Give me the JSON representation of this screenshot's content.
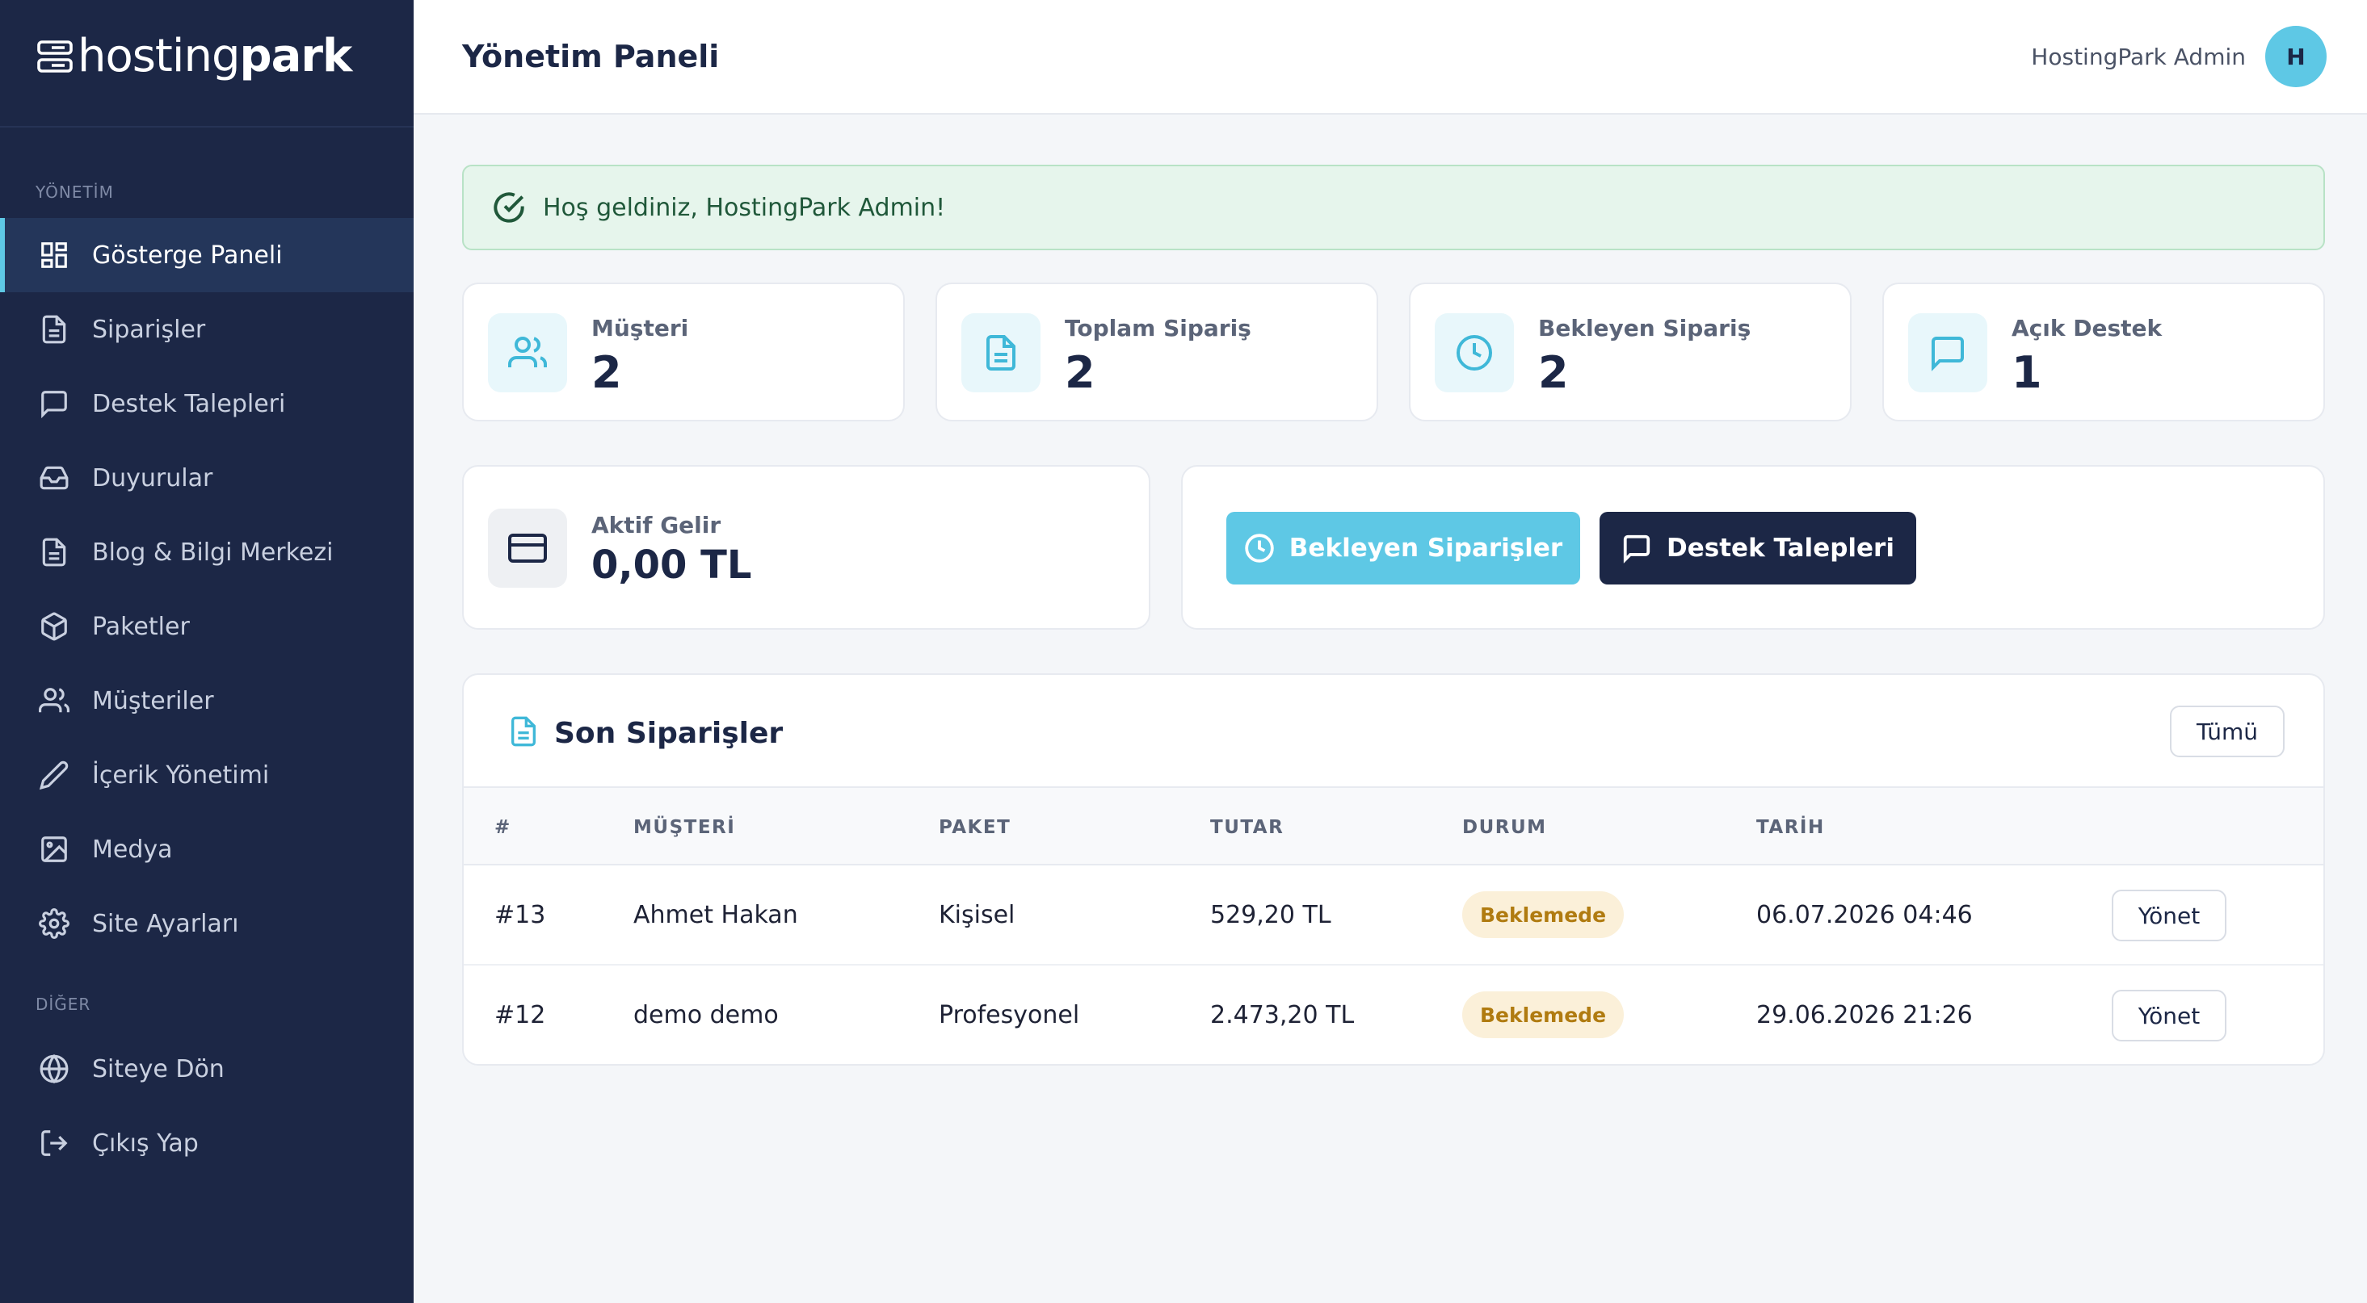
{
  "brand": {
    "name_light": "hosting",
    "name_bold": "park"
  },
  "sidebar": {
    "section_main": "YÖNETİM",
    "section_other": "DİĞER",
    "items": [
      {
        "label": "Gösterge Paneli",
        "icon": "dashboard-icon",
        "active": true
      },
      {
        "label": "Siparişler",
        "icon": "file-icon"
      },
      {
        "label": "Destek Talepleri",
        "icon": "message-icon"
      },
      {
        "label": "Duyurular",
        "icon": "inbox-icon"
      },
      {
        "label": "Blog & Bilgi Merkezi",
        "icon": "file-icon"
      },
      {
        "label": "Paketler",
        "icon": "box-icon"
      },
      {
        "label": "Müşteriler",
        "icon": "users-icon"
      },
      {
        "label": "İçerik Yönetimi",
        "icon": "pencil-icon"
      },
      {
        "label": "Medya",
        "icon": "image-icon"
      },
      {
        "label": "Site Ayarları",
        "icon": "gear-icon"
      }
    ],
    "other_items": [
      {
        "label": "Siteye Dön",
        "icon": "globe-icon"
      },
      {
        "label": "Çıkış Yap",
        "icon": "logout-icon"
      }
    ]
  },
  "header": {
    "title": "Yönetim Paneli",
    "user_name": "HostingPark Admin",
    "avatar_initial": "H"
  },
  "alert": {
    "message": "Hoş geldiniz, HostingPark Admin!"
  },
  "stats": [
    {
      "label": "Müşteri",
      "value": "2",
      "icon": "users-icon"
    },
    {
      "label": "Toplam Sipariş",
      "value": "2",
      "icon": "file-icon"
    },
    {
      "label": "Bekleyen Sipariş",
      "value": "2",
      "icon": "clock-icon"
    },
    {
      "label": "Açık Destek",
      "value": "1",
      "icon": "message-icon"
    }
  ],
  "revenue": {
    "label": "Aktif Gelir",
    "value": "0,00 TL",
    "icon": "credit-card-icon"
  },
  "quick_actions": {
    "pending_orders": "Bekleyen Siparişler",
    "support_tickets": "Destek Talepleri"
  },
  "orders": {
    "title": "Son Siparişler",
    "all_button": "Tümü",
    "columns": [
      "#",
      "MÜŞTERİ",
      "PAKET",
      "TUTAR",
      "DURUM",
      "TARİH"
    ],
    "manage_label": "Yönet",
    "rows": [
      {
        "id": "#13",
        "customer": "Ahmet Hakan",
        "package": "Kişisel",
        "amount": "529,20 TL",
        "status": "Beklemede",
        "date": "06.07.2026 04:46"
      },
      {
        "id": "#12",
        "customer": "demo demo",
        "package": "Profesyonel",
        "amount": "2.473,20 TL",
        "status": "Beklemede",
        "date": "29.06.2026 21:26"
      }
    ]
  },
  "colors": {
    "sidebar_bg": "#1c2746",
    "accent": "#5ec8e5",
    "alert_bg": "#e6f5ec",
    "badge_bg": "#fbf0d9",
    "badge_text": "#b07b10"
  }
}
